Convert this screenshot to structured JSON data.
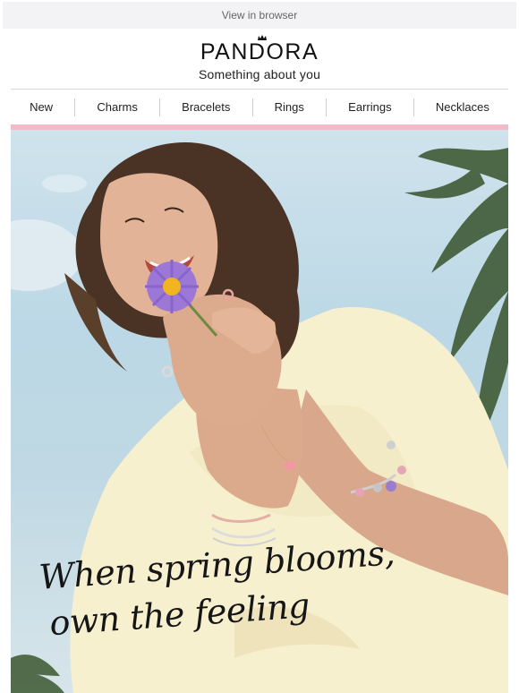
{
  "header": {
    "view_in_browser": "View in browser"
  },
  "brand": {
    "name": "PANDORA",
    "tagline": "Something about you"
  },
  "nav": {
    "items": [
      "New",
      "Charms",
      "Bracelets",
      "Rings",
      "Earrings",
      "Necklaces"
    ]
  },
  "hero": {
    "headline_line1": "When spring blooms,",
    "headline_line2": "own the feeling"
  },
  "colors": {
    "accent_pink": "#f2bac6",
    "topbar_bg": "#f3f3f6"
  }
}
